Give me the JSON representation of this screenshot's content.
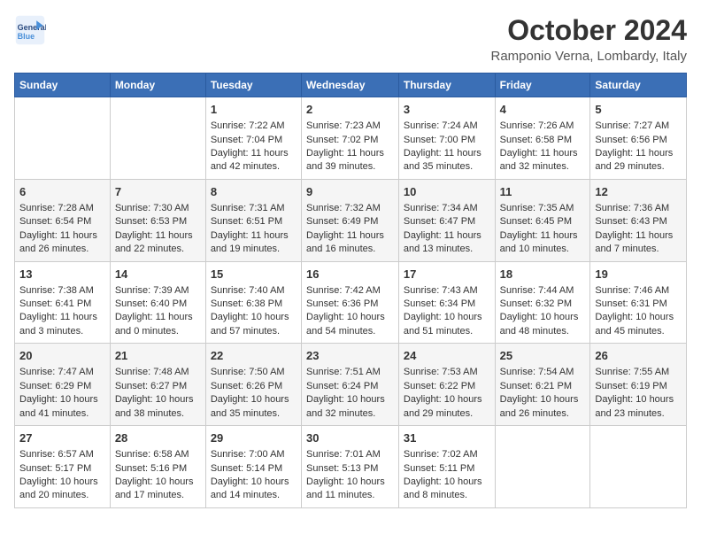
{
  "header": {
    "logo_line1": "General",
    "logo_line2": "Blue",
    "month_title": "October 2024",
    "location": "Ramponio Verna, Lombardy, Italy"
  },
  "days_of_week": [
    "Sunday",
    "Monday",
    "Tuesday",
    "Wednesday",
    "Thursday",
    "Friday",
    "Saturday"
  ],
  "weeks": [
    [
      {
        "day": "",
        "info": ""
      },
      {
        "day": "",
        "info": ""
      },
      {
        "day": "1",
        "info": "Sunrise: 7:22 AM\nSunset: 7:04 PM\nDaylight: 11 hours and 42 minutes."
      },
      {
        "day": "2",
        "info": "Sunrise: 7:23 AM\nSunset: 7:02 PM\nDaylight: 11 hours and 39 minutes."
      },
      {
        "day": "3",
        "info": "Sunrise: 7:24 AM\nSunset: 7:00 PM\nDaylight: 11 hours and 35 minutes."
      },
      {
        "day": "4",
        "info": "Sunrise: 7:26 AM\nSunset: 6:58 PM\nDaylight: 11 hours and 32 minutes."
      },
      {
        "day": "5",
        "info": "Sunrise: 7:27 AM\nSunset: 6:56 PM\nDaylight: 11 hours and 29 minutes."
      }
    ],
    [
      {
        "day": "6",
        "info": "Sunrise: 7:28 AM\nSunset: 6:54 PM\nDaylight: 11 hours and 26 minutes."
      },
      {
        "day": "7",
        "info": "Sunrise: 7:30 AM\nSunset: 6:53 PM\nDaylight: 11 hours and 22 minutes."
      },
      {
        "day": "8",
        "info": "Sunrise: 7:31 AM\nSunset: 6:51 PM\nDaylight: 11 hours and 19 minutes."
      },
      {
        "day": "9",
        "info": "Sunrise: 7:32 AM\nSunset: 6:49 PM\nDaylight: 11 hours and 16 minutes."
      },
      {
        "day": "10",
        "info": "Sunrise: 7:34 AM\nSunset: 6:47 PM\nDaylight: 11 hours and 13 minutes."
      },
      {
        "day": "11",
        "info": "Sunrise: 7:35 AM\nSunset: 6:45 PM\nDaylight: 11 hours and 10 minutes."
      },
      {
        "day": "12",
        "info": "Sunrise: 7:36 AM\nSunset: 6:43 PM\nDaylight: 11 hours and 7 minutes."
      }
    ],
    [
      {
        "day": "13",
        "info": "Sunrise: 7:38 AM\nSunset: 6:41 PM\nDaylight: 11 hours and 3 minutes."
      },
      {
        "day": "14",
        "info": "Sunrise: 7:39 AM\nSunset: 6:40 PM\nDaylight: 11 hours and 0 minutes."
      },
      {
        "day": "15",
        "info": "Sunrise: 7:40 AM\nSunset: 6:38 PM\nDaylight: 10 hours and 57 minutes."
      },
      {
        "day": "16",
        "info": "Sunrise: 7:42 AM\nSunset: 6:36 PM\nDaylight: 10 hours and 54 minutes."
      },
      {
        "day": "17",
        "info": "Sunrise: 7:43 AM\nSunset: 6:34 PM\nDaylight: 10 hours and 51 minutes."
      },
      {
        "day": "18",
        "info": "Sunrise: 7:44 AM\nSunset: 6:32 PM\nDaylight: 10 hours and 48 minutes."
      },
      {
        "day": "19",
        "info": "Sunrise: 7:46 AM\nSunset: 6:31 PM\nDaylight: 10 hours and 45 minutes."
      }
    ],
    [
      {
        "day": "20",
        "info": "Sunrise: 7:47 AM\nSunset: 6:29 PM\nDaylight: 10 hours and 41 minutes."
      },
      {
        "day": "21",
        "info": "Sunrise: 7:48 AM\nSunset: 6:27 PM\nDaylight: 10 hours and 38 minutes."
      },
      {
        "day": "22",
        "info": "Sunrise: 7:50 AM\nSunset: 6:26 PM\nDaylight: 10 hours and 35 minutes."
      },
      {
        "day": "23",
        "info": "Sunrise: 7:51 AM\nSunset: 6:24 PM\nDaylight: 10 hours and 32 minutes."
      },
      {
        "day": "24",
        "info": "Sunrise: 7:53 AM\nSunset: 6:22 PM\nDaylight: 10 hours and 29 minutes."
      },
      {
        "day": "25",
        "info": "Sunrise: 7:54 AM\nSunset: 6:21 PM\nDaylight: 10 hours and 26 minutes."
      },
      {
        "day": "26",
        "info": "Sunrise: 7:55 AM\nSunset: 6:19 PM\nDaylight: 10 hours and 23 minutes."
      }
    ],
    [
      {
        "day": "27",
        "info": "Sunrise: 6:57 AM\nSunset: 5:17 PM\nDaylight: 10 hours and 20 minutes."
      },
      {
        "day": "28",
        "info": "Sunrise: 6:58 AM\nSunset: 5:16 PM\nDaylight: 10 hours and 17 minutes."
      },
      {
        "day": "29",
        "info": "Sunrise: 7:00 AM\nSunset: 5:14 PM\nDaylight: 10 hours and 14 minutes."
      },
      {
        "day": "30",
        "info": "Sunrise: 7:01 AM\nSunset: 5:13 PM\nDaylight: 10 hours and 11 minutes."
      },
      {
        "day": "31",
        "info": "Sunrise: 7:02 AM\nSunset: 5:11 PM\nDaylight: 10 hours and 8 minutes."
      },
      {
        "day": "",
        "info": ""
      },
      {
        "day": "",
        "info": ""
      }
    ]
  ]
}
